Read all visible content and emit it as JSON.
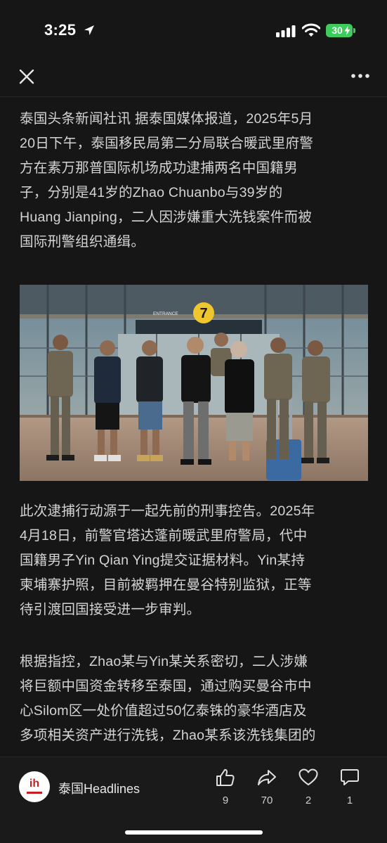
{
  "status_bar": {
    "time": "3:25",
    "battery": "30",
    "icons": [
      "location-arrow-icon",
      "cellular-signal-icon",
      "wifi-icon",
      "battery-charging-icon"
    ]
  },
  "header": {
    "icons": [
      "close-icon",
      "more-icon"
    ]
  },
  "article": {
    "paragraphs": [
      {
        "lines": [
          "泰国头条新闻社讯 据泰国媒体报道，2025年5月",
          "20日下午，泰国移民局第二分局联合暖武里府警",
          "方在素万那普国际机场成功逮捕两名中国籍男",
          "子，分别是41岁的Zhao Chuanbo与39岁的",
          "Huang Jianping，二人因涉嫌重大洗钱案件而被",
          "国际刑警组织通缉。"
        ]
      },
      {
        "lines": [
          "此次逮捕行动源于一起先前的刑事控告。2025年",
          "4月18日，前警官塔达蓬前暖武里府警局，代中",
          "国籍男子Yin Qian Ying提交证据材料。Yin某持",
          "柬埔寨护照，目前被羁押在曼谷特别监狱，正等",
          "待引渡回国接受进一步审判。"
        ]
      },
      {
        "lines": [
          "根据指控，Zhao某与Yin某关系密切，二人涉嫌",
          "将巨额中国资金转移至泰国，通过购买曼谷市中",
          "心Silom区一处价值超过50亿泰铢的豪华酒店及",
          "多项相关资产进行洗钱，Zhao某系该洗钱集团的"
        ]
      }
    ],
    "photo": {
      "gate_number": "7",
      "sign_text": "ENTRANCE"
    }
  },
  "bottom_bar": {
    "source_logo_text": "ih",
    "source_name": "泰国Headlines",
    "actions": [
      {
        "icon": "thumbs-up-icon",
        "count": "9"
      },
      {
        "icon": "share-icon",
        "count": "70"
      },
      {
        "icon": "heart-icon",
        "count": "2"
      },
      {
        "icon": "comment-icon",
        "count": "1"
      }
    ]
  },
  "colors": {
    "background": "#161616",
    "text": "#d4d4d4",
    "battery": "#3dcc5c",
    "logo_red": "#c81d25"
  }
}
